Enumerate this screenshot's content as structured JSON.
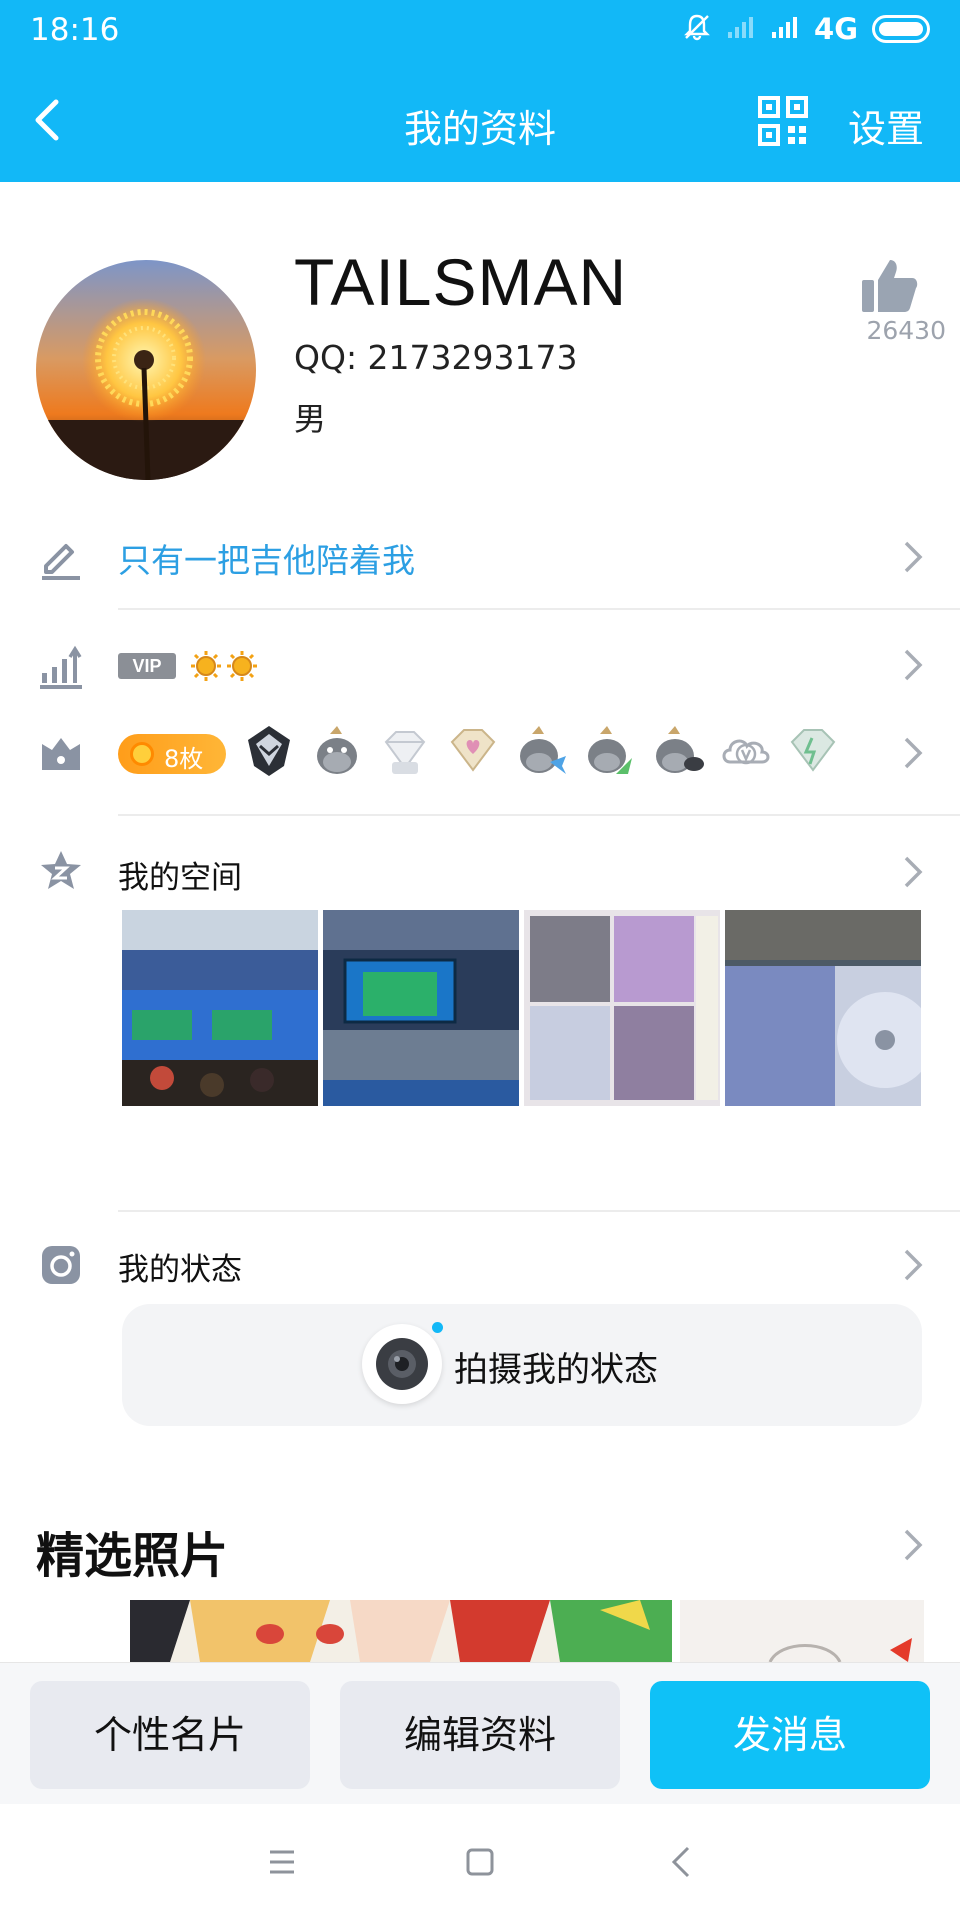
{
  "status_bar": {
    "time": "18:16",
    "network": "4G"
  },
  "nav": {
    "title": "我的资料",
    "settings_label": "设置"
  },
  "profile": {
    "name": "TAILSMAN",
    "qq_label": "QQ: 2173293173",
    "gender": "男",
    "like_count": "26430"
  },
  "signature": {
    "text": "只有一把吉他陪着我"
  },
  "vip": {
    "badge_label": "VIP"
  },
  "medals": {
    "count_label": "8枚"
  },
  "qzone": {
    "label": "我的空间"
  },
  "moments": {
    "label": "我的状态",
    "capture_label": "拍摄我的状态"
  },
  "featured": {
    "title": "精选照片"
  },
  "actions": {
    "card_label": "个性名片",
    "edit_label": "编辑资料",
    "message_label": "发消息"
  },
  "colors": {
    "brand": "#12b8f7",
    "signature": "#2c9fe3",
    "medal": "#ff9d1a"
  }
}
